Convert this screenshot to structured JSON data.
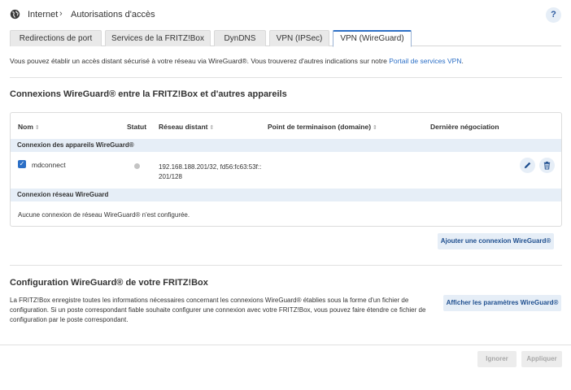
{
  "breadcrumb": {
    "root": "Internet",
    "separator": "›",
    "current": "Autorisations d'accès"
  },
  "help_label": "?",
  "tabs": [
    {
      "label": "Redirections de port",
      "active": false
    },
    {
      "label": "Services de la FRITZ!Box",
      "active": false
    },
    {
      "label": "DynDNS",
      "active": false
    },
    {
      "label": "VPN (IPSec)",
      "active": false
    },
    {
      "label": "VPN (WireGuard)",
      "active": true
    }
  ],
  "intro": {
    "text": "Vous pouvez établir un accès distant sécurisé à votre réseau via WireGuard®. Vous trouverez d'autres indications sur notre ",
    "link": "Portail de services VPN",
    "suffix": "."
  },
  "connections": {
    "title": "Connexions WireGuard® entre la FRITZ!Box et d'autres appareils",
    "columns": {
      "name": "Nom",
      "status": "Statut",
      "remote_network": "Réseau distant",
      "endpoint": "Point de terminaison (domaine)",
      "last_negotiation": "Dernière négociation"
    },
    "sort_glyph": "⇕",
    "group_devices": "Connexion des appareils WireGuard®",
    "devices": [
      {
        "checked": true,
        "name": "mdconnect",
        "status": "inactive",
        "remote_network_line1": "192.168.188.201/32, fd56:fc63:53f::",
        "remote_network_line2": "201/128",
        "endpoint": "",
        "last_negotiation": ""
      }
    ],
    "group_network": "Connexion réseau WireGuard",
    "network_empty": "Aucune connexion de réseau WireGuard® n'est configurée.",
    "add_button": "Ajouter une connexion WireGuard®"
  },
  "config": {
    "title": "Configuration WireGuard® de votre FRITZ!Box",
    "text": "La FRITZ!Box enregistre toutes les informations nécessaires concernant les connexions WireGuard® établies sous la forme d'un fichier de configuration. Si un poste correspondant fiable souhaite configurer une connexion avec votre FRITZ!Box, vous pouvez faire étendre ce fichier de configuration par le poste correspondant.",
    "show_button": "Afficher les paramètres WireGuard®"
  },
  "footer": {
    "ignore": "Ignorer",
    "apply": "Appliquer"
  },
  "icons": {
    "globe": "globe-icon",
    "edit": "pencil-icon",
    "delete": "trash-icon",
    "check": "check-icon"
  },
  "colors": {
    "accent": "#2c6fc6",
    "button_bg": "#e6eef7",
    "status_inactive": "#c4c4c4"
  }
}
